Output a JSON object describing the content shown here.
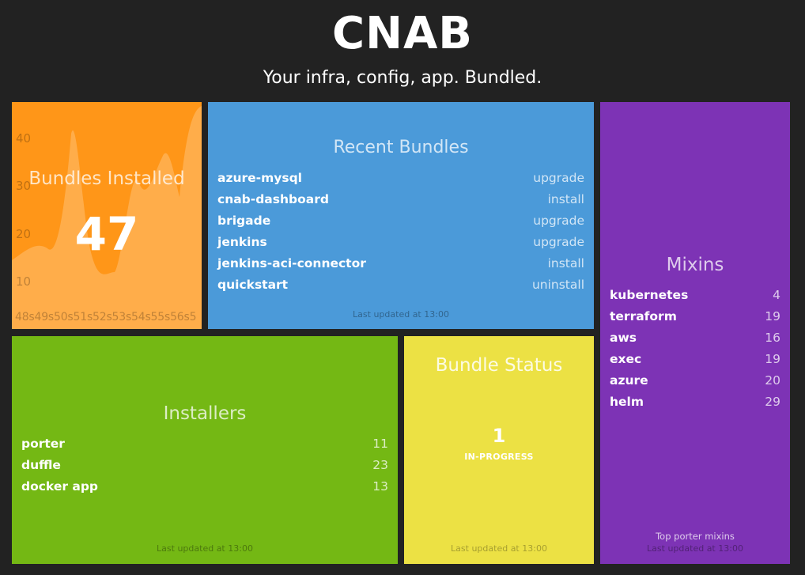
{
  "header": {
    "title": "CNAB",
    "subtitle": "Your infra, config, app. Bundled."
  },
  "bundles_installed": {
    "title": "Bundles Installed",
    "value": "47",
    "y_ticks": [
      "40",
      "30",
      "20",
      "10"
    ],
    "x_ticks": "48s49s50s51s52s53s54s55s56s5",
    "color": "#ff9618"
  },
  "recent_bundles": {
    "title": "Recent Bundles",
    "items": [
      {
        "label": "azure-mysql",
        "value": "upgrade"
      },
      {
        "label": "cnab-dashboard",
        "value": "install"
      },
      {
        "label": "brigade",
        "value": "upgrade"
      },
      {
        "label": "jenkins",
        "value": "upgrade"
      },
      {
        "label": "jenkins-aci-connector",
        "value": "install"
      },
      {
        "label": "quickstart",
        "value": "uninstall"
      }
    ],
    "updated": "Last updated at 13:00",
    "color": "#4b9ad9"
  },
  "mixins": {
    "title": "Mixins",
    "items": [
      {
        "label": "kubernetes",
        "value": "4"
      },
      {
        "label": "terraform",
        "value": "19"
      },
      {
        "label": "aws",
        "value": "16"
      },
      {
        "label": "exec",
        "value": "19"
      },
      {
        "label": "azure",
        "value": "20"
      },
      {
        "label": "helm",
        "value": "29"
      }
    ],
    "more_info": "Top porter mixins",
    "updated": "Last updated at 13:00",
    "color": "#7d33b5"
  },
  "installers": {
    "title": "Installers",
    "items": [
      {
        "label": "porter",
        "value": "11"
      },
      {
        "label": "duffle",
        "value": "23"
      },
      {
        "label": "docker app",
        "value": "13"
      }
    ],
    "updated": "Last updated at 13:00",
    "color": "#74b814"
  },
  "bundle_status": {
    "title": "Bundle Status",
    "value": "1",
    "label": "IN-PROGRESS",
    "updated": "Last updated at 13:00",
    "color": "#ece144"
  }
}
